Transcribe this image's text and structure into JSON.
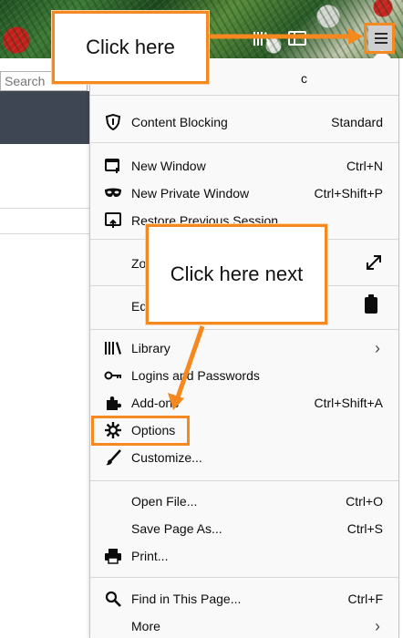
{
  "search": {
    "placeholder": "Search"
  },
  "menu": {
    "header_tail": "c",
    "sections": [
      {
        "items": [
          {
            "icon": "shield-icon",
            "label": "Content Blocking",
            "shortcut": "Standard"
          }
        ]
      },
      {
        "items": [
          {
            "icon": "new-window-icon",
            "label": "New Window",
            "shortcut": "Ctrl+N"
          },
          {
            "icon": "mask-icon",
            "label": "New Private Window",
            "shortcut": "Ctrl+Shift+P"
          },
          {
            "icon": "restore-session-icon",
            "label": "Restore Previous Session",
            "shortcut": ""
          }
        ]
      },
      {
        "items": [
          {
            "icon": "",
            "label": "Zo",
            "shortcut": ""
          }
        ]
      },
      {
        "items": [
          {
            "icon": "",
            "label": "Ed",
            "shortcut": ""
          }
        ]
      },
      {
        "items": [
          {
            "icon": "library-icon",
            "label": "Library",
            "shortcut": ""
          },
          {
            "icon": "key-icon",
            "label": "Logins and Passwords",
            "shortcut": ""
          },
          {
            "icon": "puzzle-icon",
            "label": "Add-ons",
            "shortcut": "Ctrl+Shift+A"
          },
          {
            "icon": "gear-icon",
            "label": "Options",
            "shortcut": ""
          },
          {
            "icon": "brush-icon",
            "label": "Customize...",
            "shortcut": ""
          }
        ]
      },
      {
        "items": [
          {
            "icon": "",
            "label": "Open File...",
            "shortcut": "Ctrl+O"
          },
          {
            "icon": "",
            "label": "Save Page As...",
            "shortcut": "Ctrl+S"
          },
          {
            "icon": "printer-icon",
            "label": "Print...",
            "shortcut": ""
          }
        ]
      },
      {
        "items": [
          {
            "icon": "magnifier-icon",
            "label": "Find in This Page...",
            "shortcut": "Ctrl+F"
          },
          {
            "icon": "",
            "label": "More",
            "shortcut": ""
          }
        ]
      }
    ]
  },
  "callouts": {
    "first": "Click here",
    "second": "Click here next"
  },
  "colors": {
    "accent": "#f5891f",
    "panel": "#f9f9fa"
  }
}
